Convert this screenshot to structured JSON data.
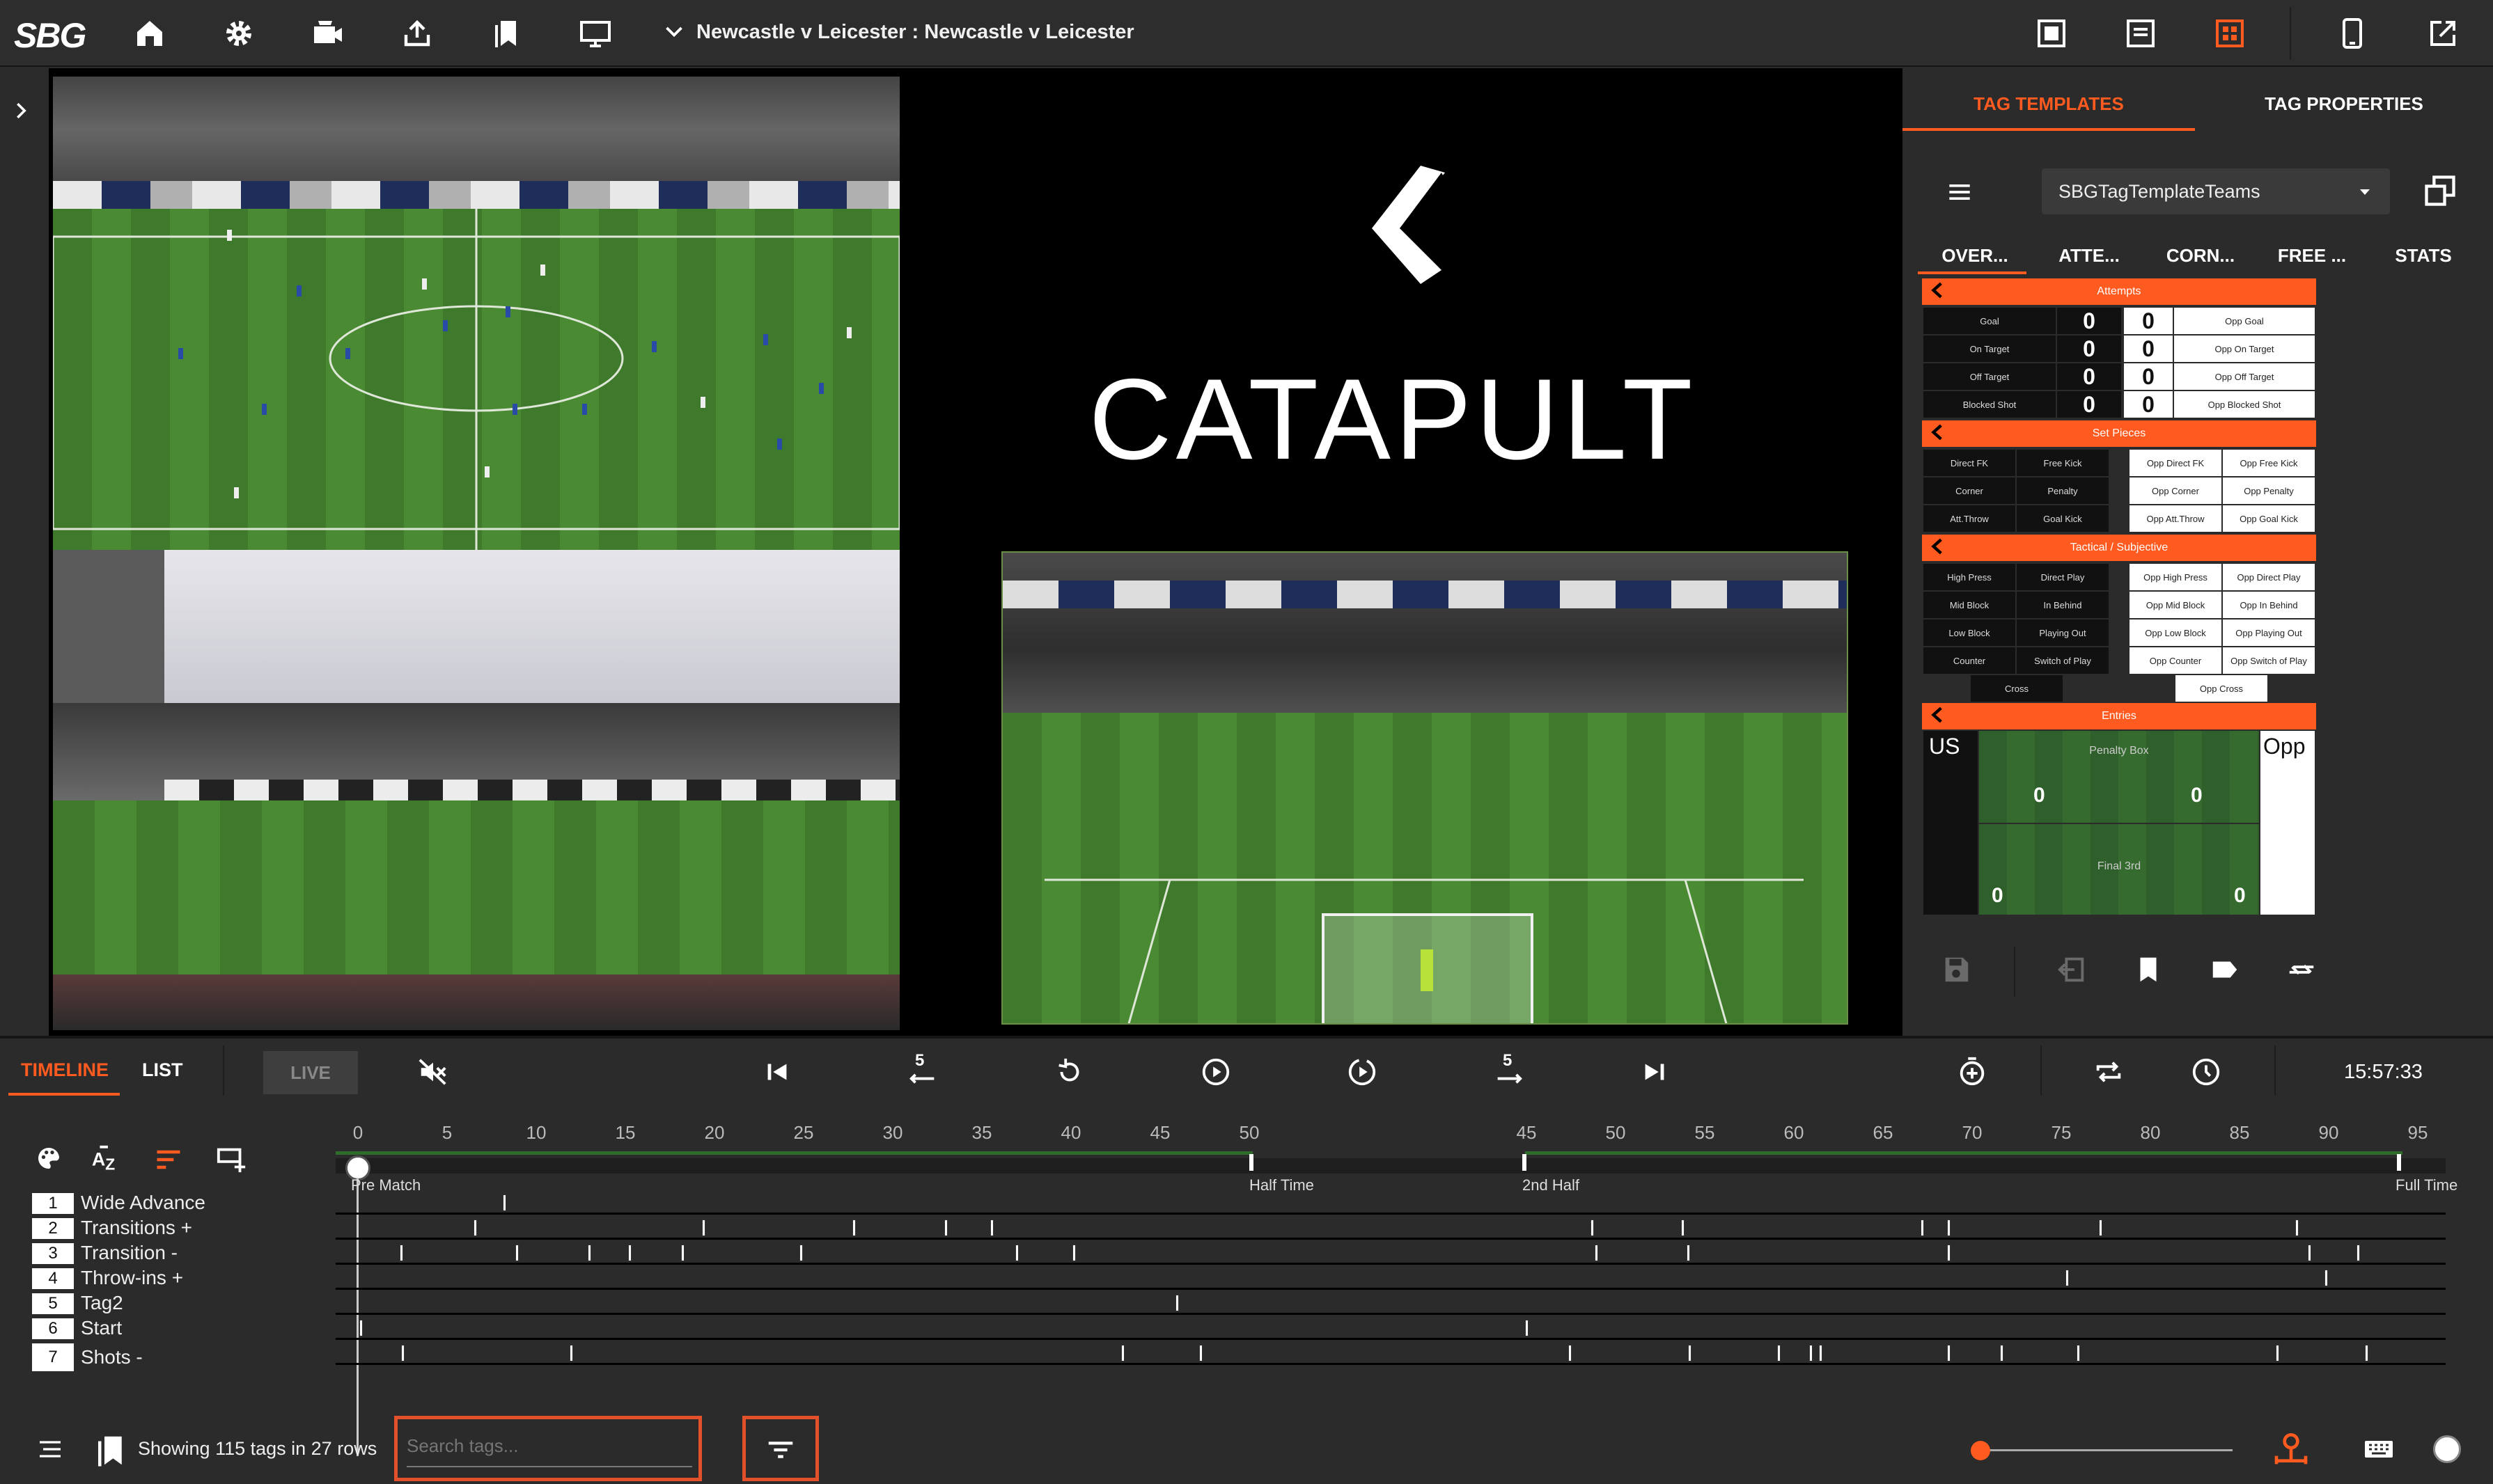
{
  "topbar": {
    "logo": "SBG",
    "match_title": "Newcastle v Leicester : Newcastle v Leicester",
    "icons": [
      "home-icon",
      "gear-icon",
      "camera-icon",
      "upload-icon",
      "bookmarks-icon",
      "monitor-icon",
      "chevron-down-icon",
      "layout-single-icon",
      "layout-document-icon",
      "layout-grid-icon",
      "tablet-icon",
      "external-link-icon"
    ],
    "accent_color": "#ff5a1f"
  },
  "video": {
    "brand": "CATAPULT"
  },
  "right_panel": {
    "tabs": [
      "TAG TEMPLATES",
      "TAG PROPERTIES"
    ],
    "template_name": "SBGTagTemplateTeams",
    "category_tabs": [
      "OVER...",
      "ATTE...",
      "CORN...",
      "FREE ...",
      "STATS"
    ],
    "attempts": {
      "header": "Attempts",
      "rows": [
        {
          "label": "Goal",
          "us": "0",
          "opp": "0",
          "opp_label": "Opp Goal"
        },
        {
          "label": "On Target",
          "us": "0",
          "opp": "0",
          "opp_label": "Opp On Target"
        },
        {
          "label": "Off Target",
          "us": "0",
          "opp": "0",
          "opp_label": "Opp Off Target"
        },
        {
          "label": "Blocked Shot",
          "us": "0",
          "opp": "0",
          "opp_label": "Opp Blocked Shot"
        }
      ]
    },
    "set_pieces": {
      "header": "Set Pieces",
      "rows": [
        [
          "Direct FK",
          "Free Kick",
          "Opp Direct FK",
          "Opp Free Kick"
        ],
        [
          "Corner",
          "Penalty",
          "Opp Corner",
          "Opp Penalty"
        ],
        [
          "Att.Throw",
          "Goal Kick",
          "Opp Att.Throw",
          "Opp Goal Kick"
        ]
      ]
    },
    "tactical": {
      "header": "Tactical / Subjective",
      "rows": [
        [
          "High Press",
          "Direct Play",
          "Opp High Press",
          "Opp Direct Play"
        ],
        [
          "Mid Block",
          "In Behind",
          "Opp Mid Block",
          "Opp In Behind"
        ],
        [
          "Low Block",
          "Playing Out",
          "Opp Low Block",
          "Opp Playing Out"
        ],
        [
          "Counter",
          "Switch of Play",
          "Opp Counter",
          "Opp Switch of Play"
        ]
      ],
      "extra": [
        "Cross",
        "Opp Cross"
      ]
    },
    "entries": {
      "header": "Entries",
      "us_label": "US",
      "opp_label": "Opp",
      "penalty_box": "Penalty Box",
      "final_third": "Final 3rd",
      "pb_us": "0",
      "pb_opp": "0",
      "f3_us": "0",
      "f3_opp": "0"
    }
  },
  "bottom": {
    "tabs": [
      "TIMELINE",
      "LIST"
    ],
    "live_label": "LIVE",
    "skip_back_label": "5",
    "skip_fwd_label": "5",
    "clock": "15:57:33",
    "ruler": [
      0,
      5,
      10,
      15,
      20,
      25,
      30,
      35,
      40,
      45,
      50,
      45,
      50,
      55,
      60,
      65,
      70,
      75,
      80,
      85,
      90,
      95
    ],
    "segments": [
      "Pre Match",
      "Half Time",
      "2nd Half",
      "Full Time"
    ],
    "rows": [
      {
        "num": "1",
        "label": "Wide Advance"
      },
      {
        "num": "2",
        "label": "Transitions +"
      },
      {
        "num": "3",
        "label": "Transition -"
      },
      {
        "num": "4",
        "label": "Throw-ins +"
      },
      {
        "num": "5",
        "label": "Tag2"
      },
      {
        "num": "6",
        "label": "Start"
      },
      {
        "num": "7",
        "label": "Shots -"
      }
    ],
    "status": "Showing 115 tags in 27 rows",
    "search_placeholder": "Search tags..."
  }
}
